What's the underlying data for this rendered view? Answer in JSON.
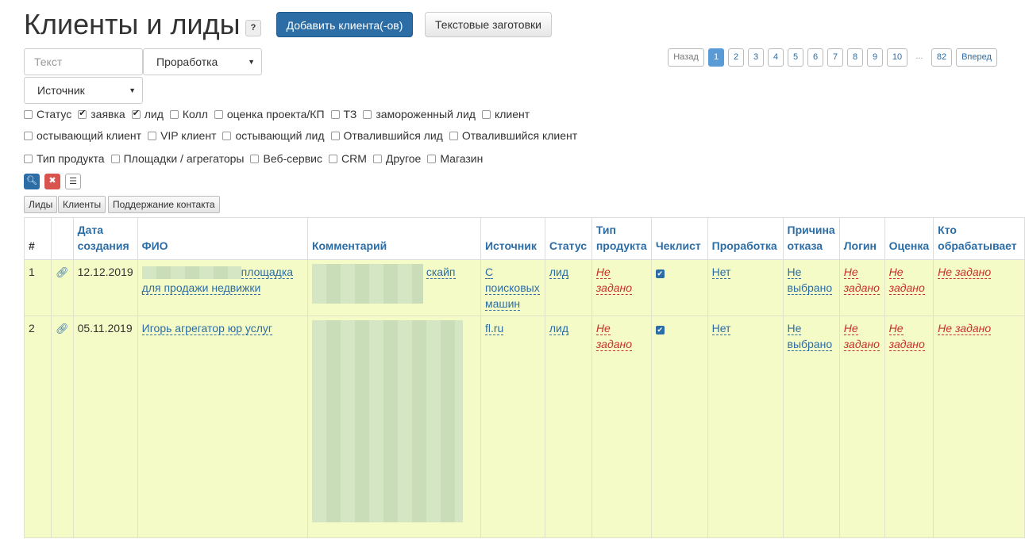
{
  "header": {
    "title": "Клиенты и лиды",
    "help": "?",
    "add_button": "Добавить клиента(-ов)",
    "templates_button": "Текстовые заготовки"
  },
  "filters": {
    "text_placeholder": "Текст",
    "processing_select": "Проработка",
    "source_select": "Источник"
  },
  "pagination": {
    "back": "Назад",
    "pages": [
      "1",
      "2",
      "3",
      "4",
      "5",
      "6",
      "7",
      "8",
      "9",
      "10"
    ],
    "dots": "...",
    "last": "82",
    "next": "Вперед",
    "active_page": "1"
  },
  "checkboxes": {
    "row1": [
      {
        "label": "Статус",
        "checked": false
      },
      {
        "label": "заявка",
        "checked": true
      },
      {
        "label": "лид",
        "checked": true
      },
      {
        "label": "Колл",
        "checked": false
      },
      {
        "label": "оценка проекта/КП",
        "checked": false
      },
      {
        "label": "ТЗ",
        "checked": false
      },
      {
        "label": "замороженный лид",
        "checked": false
      },
      {
        "label": "клиент",
        "checked": false
      }
    ],
    "row2": [
      {
        "label": "остывающий клиент",
        "checked": false
      },
      {
        "label": "VIP клиент",
        "checked": false
      },
      {
        "label": "остывающий лид",
        "checked": false
      },
      {
        "label": "Отвалившийся лид",
        "checked": false
      },
      {
        "label": "Отвалившийся клиент",
        "checked": false
      }
    ],
    "row3": [
      {
        "label": "Тип продукта",
        "checked": false
      },
      {
        "label": "Площадки / агрегаторы",
        "checked": false
      },
      {
        "label": "Веб-сервис",
        "checked": false
      },
      {
        "label": "CRM",
        "checked": false
      },
      {
        "label": "Другое",
        "checked": false
      },
      {
        "label": "Магазин",
        "checked": false
      }
    ]
  },
  "tabs": [
    "Лиды",
    "Клиенты",
    "Поддержание контакта"
  ],
  "table": {
    "headers": {
      "num": "#",
      "date": "Дата создания",
      "fio": "ФИО",
      "comment": "Комментарий",
      "source": "Источник",
      "status": "Статус",
      "product": "Тип продукта",
      "checklist": "Чеклист",
      "processing": "Проработка",
      "reason": "Причина отказа",
      "login": "Логин",
      "rating": "Оценка",
      "handler": "Кто обрабатывает"
    },
    "rows": [
      {
        "num": "1",
        "date": "12.12.2019",
        "fio": "площадка для продажи недвижки",
        "comment": "скайп",
        "source": "С поисковых машин",
        "status": "лид",
        "product": "Не задано",
        "processing": "Нет",
        "reason": "Не выбрано",
        "login": "Не задано",
        "rating": "Не задано",
        "handler": "Не задано"
      },
      {
        "num": "2",
        "date": "05.11.2019",
        "fio": "Игорь агрегатор юр услуг",
        "comment": "",
        "source": "fl.ru",
        "status": "лид",
        "product": "Не задано",
        "processing": "Нет",
        "reason": "Не выбрано",
        "login": "Не задано",
        "rating": "Не задано",
        "handler": "Не задано"
      }
    ]
  }
}
